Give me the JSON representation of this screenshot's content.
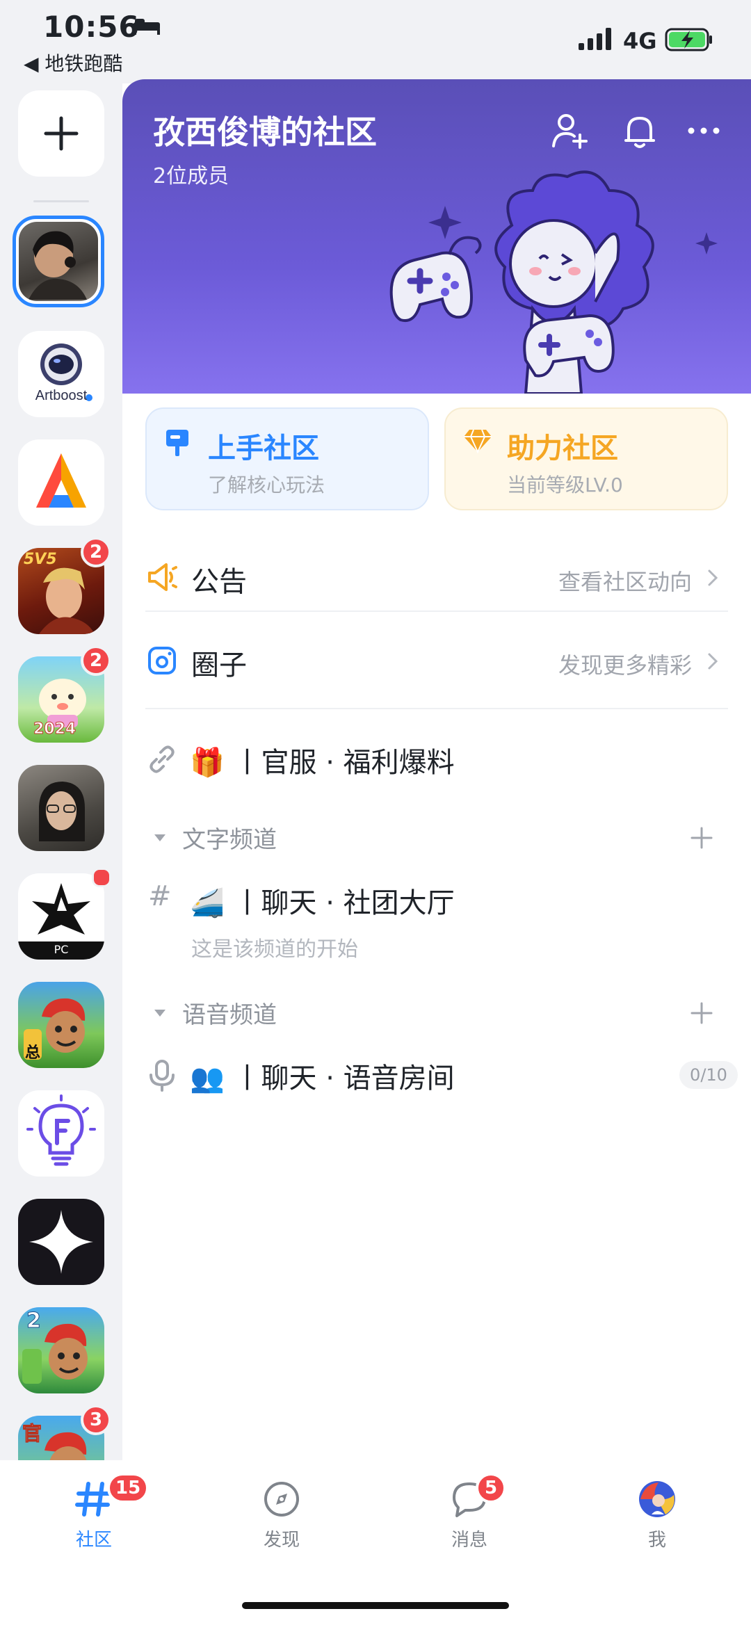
{
  "status_bar": {
    "time": "10:56",
    "back_app": "◀ 地铁跑酷",
    "network": "4G"
  },
  "rail": {
    "items": [
      {
        "name": "add-community",
        "icon": "plus-icon"
      },
      {
        "name": "community-avatar-selected",
        "selected": true
      },
      {
        "name": "artboost",
        "label": "Artboost"
      },
      {
        "name": "app-a-logo"
      },
      {
        "name": "5v5-game",
        "badge": "2",
        "art_label": "5V5"
      },
      {
        "name": "egg-party-game",
        "badge": "2",
        "art_label": "2024"
      },
      {
        "name": "user-avatar"
      },
      {
        "name": "star-pc-game",
        "dot": true,
        "art_label": "PC"
      },
      {
        "name": "subway-surfers-1",
        "art_label": "总"
      },
      {
        "name": "f-bulb-app"
      },
      {
        "name": "sparkle-app"
      },
      {
        "name": "subway-surfers-2",
        "art_label": "2"
      },
      {
        "name": "subway-surfers-3",
        "badge": "3",
        "art_label": "官"
      }
    ]
  },
  "header": {
    "community_name": "孜西俊博的社区",
    "member_count": "2位成员",
    "icons": [
      "add-member-icon",
      "bell-icon",
      "more-icon"
    ]
  },
  "cards": {
    "guide": {
      "title": "上手社区",
      "subtitle": "了解核心玩法",
      "color": "#2a86ff"
    },
    "help": {
      "title": "助力社区",
      "subtitle": "当前等级LV.0",
      "color": "#f5a623"
    }
  },
  "rows": {
    "announcement": {
      "label": "公告",
      "hint": "查看社区动向"
    },
    "circle": {
      "label": "圈子",
      "hint": "发现更多精彩"
    },
    "link_channel": {
      "emoji": "🎁",
      "label": "丨官服 · 福利爆料"
    }
  },
  "text_section": {
    "title": "文字频道",
    "channel": {
      "emoji": "🚄",
      "label": "丨聊天 · 社团大厅",
      "subtitle": "这是该频道的开始"
    }
  },
  "voice_section": {
    "title": "语音频道",
    "channel": {
      "emoji": "👥",
      "label": "丨聊天 · 语音房间",
      "count": "0/10"
    }
  },
  "tabbar": {
    "tabs": [
      {
        "label": "社区",
        "icon": "hash-icon",
        "badge": "15",
        "active": true
      },
      {
        "label": "发现",
        "icon": "compass-icon"
      },
      {
        "label": "消息",
        "icon": "chat-icon",
        "badge": "5"
      },
      {
        "label": "我",
        "icon": "avatar-icon"
      }
    ]
  },
  "colors": {
    "accent": "#2a86ff",
    "badge": "#f2464a",
    "hero": "#6c5bd8"
  }
}
